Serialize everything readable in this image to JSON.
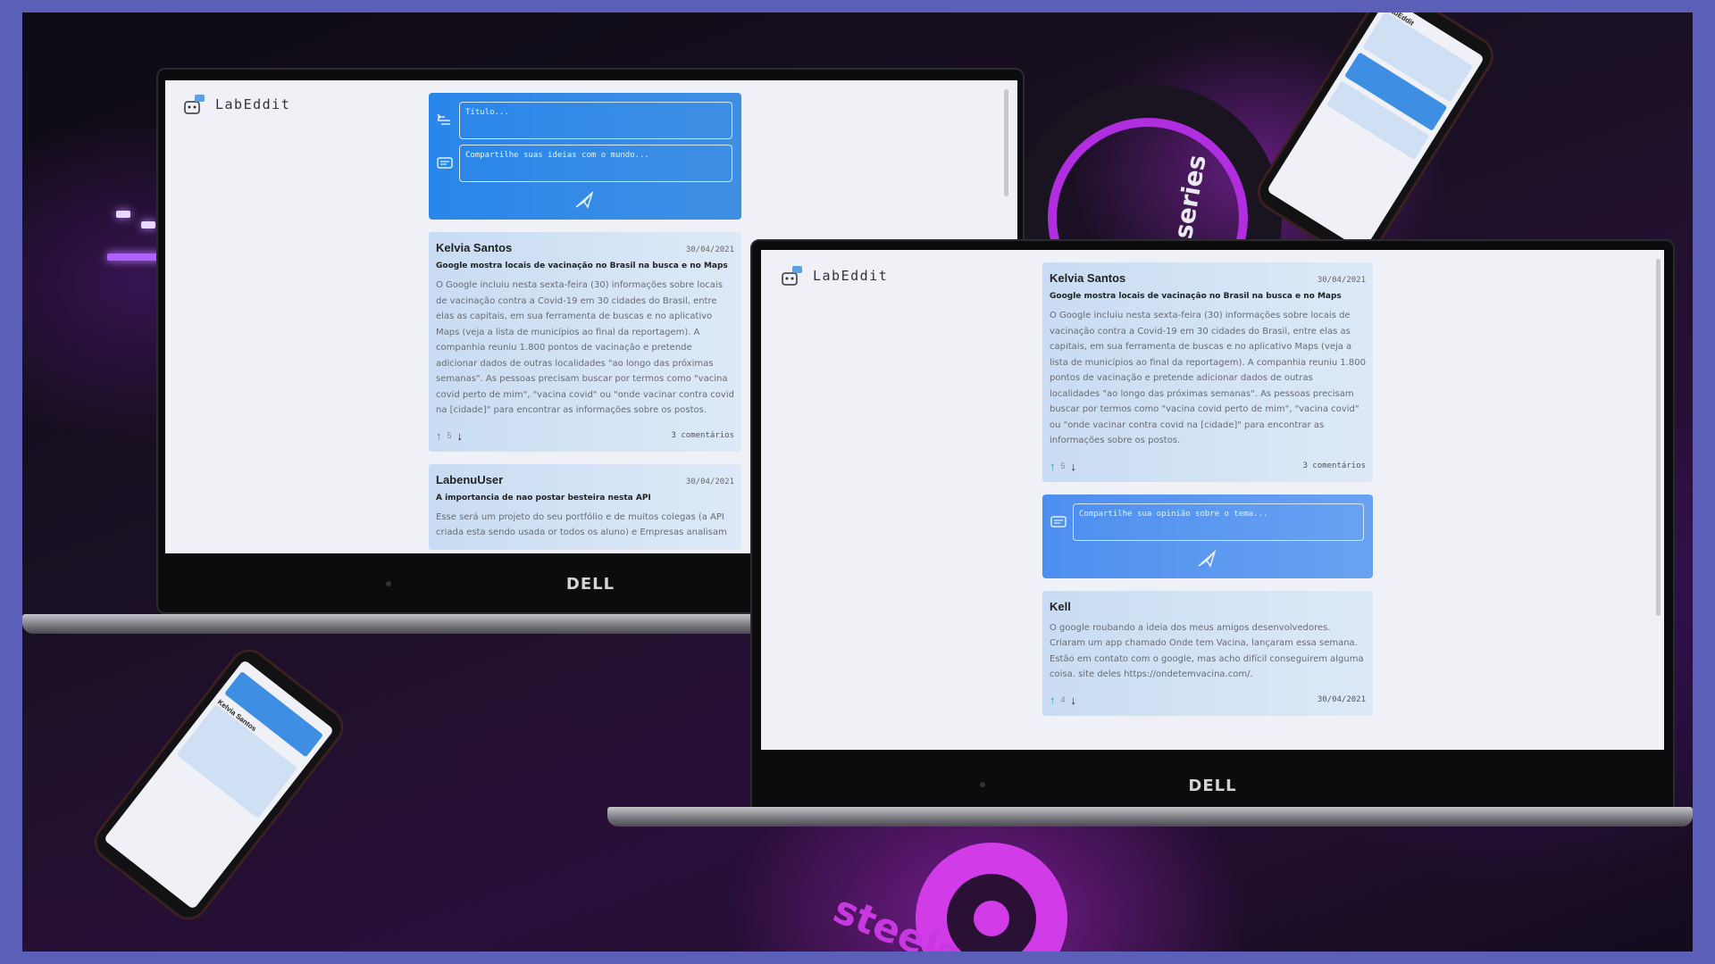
{
  "app": {
    "name": "LabEddit"
  },
  "brand": {
    "laptop": "DELL",
    "headset": "series",
    "mousepad": "steels"
  },
  "colors": {
    "frame": "#5b5fb8",
    "composer": "#2a86ea",
    "card": "#c9dcf3",
    "upvote": "#2aa5a0"
  },
  "composer_post": {
    "title_placeholder": "Título...",
    "body_placeholder": "Compartilhe suas ideias com o mundo...",
    "icons": [
      "title-icon",
      "chat-icon",
      "send-icon"
    ]
  },
  "composer_comment": {
    "placeholder": "Compartilhe sua opinião sobre o tema..."
  },
  "posts": [
    {
      "author": "Kelvia Santos",
      "date": "30/04/2021",
      "title": "Google mostra locais de vacinação no Brasil na busca e no Maps",
      "body": "O Google incluiu nesta sexta-feira (30) informações sobre locais de vacinação contra a Covid-19 em 30 cidades do Brasil, entre elas as capitais, em sua ferramenta de buscas e no aplicativo Maps (veja a lista de municípios ao final da reportagem). A companhia reuniu 1.800 pontos de vacinação e pretende adicionar dados de outras localidades \"ao longo das próximas semanas\". As pessoas precisam buscar por termos como \"vacina covid perto de mim\", \"vacina covid\" ou \"onde vacinar contra covid na [cidade]\" para encontrar as informações sobre os postos.",
      "votes": "5",
      "comments": "3 comentários"
    },
    {
      "author": "LabenuUser",
      "date": "30/04/2021",
      "title": "A importancia de nao postar besteira nesta API",
      "body": "Esse será um projeto do seu portfólio e de muitos colegas (a API criada esta sendo usada or todos os aluno) e Empresas analisam"
    }
  ],
  "comment": {
    "author": "Kell",
    "body": "O google roubando a ideia dos meus amigos desenvolvedores. Criaram um app chamado Onde tem Vacina, lançaram essa semana. Estão em contato com o google, mas acho difícil conseguirem alguma coisa. site deles https://ondetemvacina.com/.",
    "votes": "4",
    "date": "30/04/2021"
  }
}
